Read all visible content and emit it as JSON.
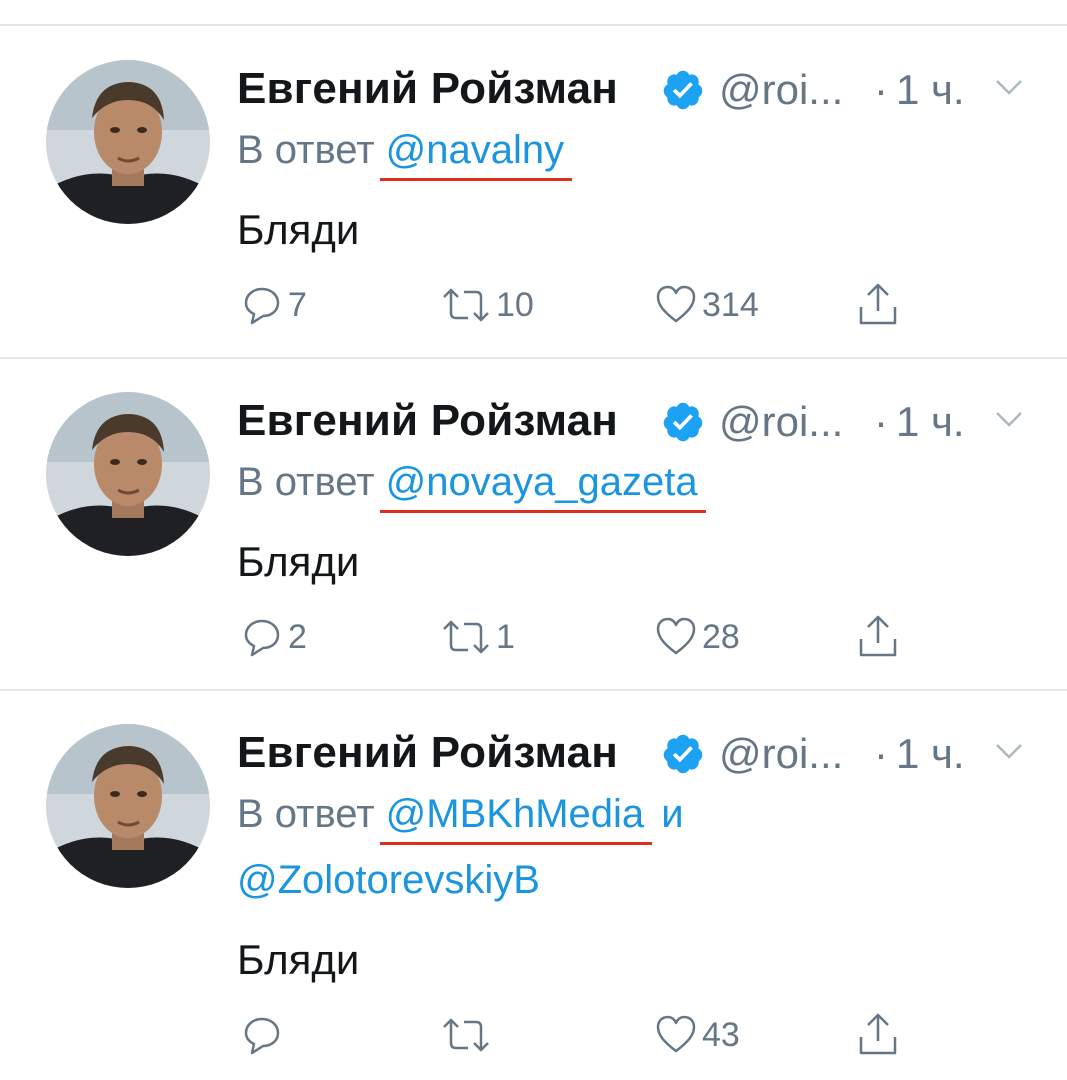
{
  "tweets": [
    {
      "author_name": "Евгений Ройзман",
      "handle": "@roi...",
      "separator": "·",
      "time": "1 ч.",
      "reply_prefix": "В ответ",
      "mentions": [
        "@navalny"
      ],
      "conjunction": "",
      "second_line_mention": "",
      "text": "Бляди",
      "counts": {
        "replies": "7",
        "retweets": "10",
        "likes": "314"
      }
    },
    {
      "author_name": "Евгений Ройзман",
      "handle": "@roi...",
      "separator": "·",
      "time": "1 ч.",
      "reply_prefix": "В ответ",
      "mentions": [
        "@novaya_gazeta"
      ],
      "conjunction": "",
      "second_line_mention": "",
      "text": "Бляди",
      "counts": {
        "replies": "2",
        "retweets": "1",
        "likes": "28"
      }
    },
    {
      "author_name": "Евгений Ройзман",
      "handle": "@roi...",
      "separator": "·",
      "time": "1 ч.",
      "reply_prefix": "В ответ",
      "mentions": [
        "@MBKhMedia"
      ],
      "conjunction": "и",
      "second_line_mention": "@ZolotorevskiyB",
      "text": "Бляди",
      "counts": {
        "replies": "",
        "retweets": "",
        "likes": "43"
      }
    }
  ],
  "icons": {
    "verified": "verified-badge-icon",
    "more": "chevron-down-icon",
    "reply": "reply-bubble-icon",
    "retweet": "retweet-icon",
    "like": "heart-icon",
    "share": "share-icon"
  },
  "colors": {
    "link": "#1b95e0",
    "secondary_text": "#657786",
    "primary_text": "#14171a",
    "verified": "#1da1f2",
    "annotation_underline": "#d9301e",
    "divider": "#e1e8ed"
  }
}
